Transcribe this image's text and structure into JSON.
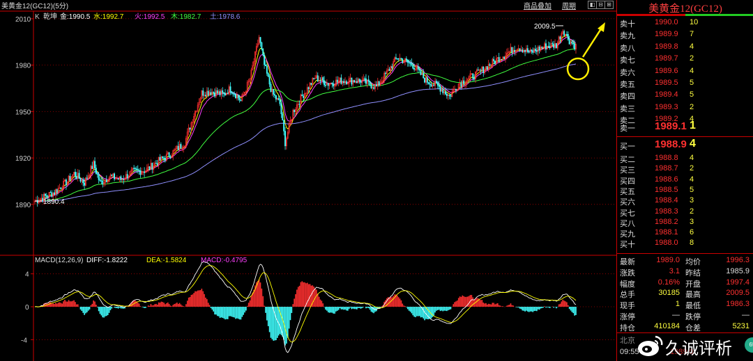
{
  "window": {
    "title": "美黄金12(GC12)(5分)",
    "buttons": [
      "商品叠加",
      "周期"
    ],
    "controls": [
      "◧",
      "⊟",
      "⊞",
      "✕"
    ]
  },
  "legend": {
    "k": "K",
    "indicator": "乾坤",
    "gold": "金:1990.5",
    "water": "水:1992.7",
    "fire": "火:1992.5",
    "wood": "木:1982.7",
    "earth": "土:1978.6",
    "colors": {
      "gold": "#ffffff",
      "water": "#ffff00",
      "fire": "#ff40ff",
      "wood": "#40ff40",
      "earth": "#9090ff"
    }
  },
  "annotations": {
    "high_label": "2009.5",
    "low_label": "1890.4"
  },
  "macd_legend": {
    "name": "MACD(12,26,9)",
    "diff": "DIFF:-1.8222",
    "dea": "DEA:-1.5824",
    "macd": "MACD:-0.4795"
  },
  "chart_data": [
    {
      "type": "candlestick",
      "title": "美黄金12(GC12)(5分)",
      "y_ticks": [
        "2010",
        "1980",
        "1950",
        "1920",
        "1890"
      ],
      "ylim": [
        1858,
        2014
      ],
      "series": [
        {
          "name": "金",
          "value": 1990.5
        },
        {
          "name": "水",
          "value": 1992.7
        },
        {
          "name": "火",
          "value": 1992.5
        },
        {
          "name": "木",
          "value": 1982.7
        },
        {
          "name": "土",
          "value": 1978.6
        }
      ],
      "close_path": [
        [
          0,
          1892
        ],
        [
          15,
          1898
        ],
        [
          25,
          1905
        ],
        [
          30,
          1910
        ],
        [
          38,
          1904
        ],
        [
          45,
          1916
        ],
        [
          50,
          1904
        ],
        [
          58,
          1908
        ],
        [
          66,
          1906
        ],
        [
          75,
          1911
        ],
        [
          85,
          1912
        ],
        [
          95,
          1918
        ],
        [
          105,
          1923
        ],
        [
          115,
          1930
        ],
        [
          122,
          1948
        ],
        [
          128,
          1962
        ],
        [
          135,
          1963
        ],
        [
          145,
          1961
        ],
        [
          150,
          1965
        ],
        [
          158,
          1957
        ],
        [
          165,
          1971
        ],
        [
          172,
          1998
        ],
        [
          176,
          1980
        ],
        [
          182,
          1962
        ],
        [
          188,
          1955
        ],
        [
          192,
          1930
        ],
        [
          198,
          1950
        ],
        [
          205,
          1960
        ],
        [
          215,
          1972
        ],
        [
          225,
          1968
        ],
        [
          235,
          1970
        ],
        [
          250,
          1970
        ],
        [
          262,
          1966
        ],
        [
          270,
          1975
        ],
        [
          278,
          1985
        ],
        [
          290,
          1980
        ],
        [
          300,
          1970
        ],
        [
          310,
          1966
        ],
        [
          318,
          1960
        ],
        [
          325,
          1968
        ],
        [
          340,
          1975
        ],
        [
          355,
          1984
        ],
        [
          370,
          1992
        ],
        [
          380,
          1988
        ],
        [
          390,
          1992
        ],
        [
          400,
          1993
        ],
        [
          405,
          2003
        ],
        [
          410,
          1996
        ],
        [
          415,
          1992
        ]
      ],
      "annotations": [
        {
          "label": "2009.5",
          "x": 405,
          "y": 2009.5
        },
        {
          "label": "1890.4",
          "x": 0,
          "y": 1890.4
        }
      ]
    },
    {
      "type": "bar",
      "title": "MACD(12,26,9)",
      "y_ticks": [
        "4",
        "0",
        "-4"
      ],
      "ylim": [
        -6,
        6
      ],
      "series": [
        {
          "name": "DIFF",
          "value": -1.8222
        },
        {
          "name": "DEA",
          "value": -1.5824
        },
        {
          "name": "MACD",
          "value": -0.4795
        }
      ]
    }
  ],
  "quote_panel": {
    "title": "美黄金12(GC12)",
    "asks": [
      {
        "label": "卖十",
        "price": "1990.0",
        "vol": "10"
      },
      {
        "label": "卖九",
        "price": "1989.9",
        "vol": "7"
      },
      {
        "label": "卖八",
        "price": "1989.8",
        "vol": "4"
      },
      {
        "label": "卖七",
        "price": "1989.7",
        "vol": "2"
      },
      {
        "label": "卖六",
        "price": "1989.6",
        "vol": "4"
      },
      {
        "label": "卖五",
        "price": "1989.5",
        "vol": "5"
      },
      {
        "label": "卖四",
        "price": "1989.4",
        "vol": "5"
      },
      {
        "label": "卖三",
        "price": "1989.3",
        "vol": "2"
      },
      {
        "label": "卖二",
        "price": "1989.2",
        "vol": "4"
      }
    ],
    "ask1": {
      "label": "卖一",
      "price": "1989.1",
      "vol": "1"
    },
    "bid1": {
      "label": "买一",
      "price": "1988.9",
      "vol": "4"
    },
    "bids": [
      {
        "label": "买二",
        "price": "1988.8",
        "vol": "4"
      },
      {
        "label": "买三",
        "price": "1988.7",
        "vol": "2"
      },
      {
        "label": "买四",
        "price": "1988.6",
        "vol": "4"
      },
      {
        "label": "买五",
        "price": "1988.5",
        "vol": "5"
      },
      {
        "label": "买六",
        "price": "1988.4",
        "vol": "3"
      },
      {
        "label": "买七",
        "price": "1988.3",
        "vol": "2"
      },
      {
        "label": "买八",
        "price": "1988.2",
        "vol": "3"
      },
      {
        "label": "买九",
        "price": "1988.1",
        "vol": "6"
      },
      {
        "label": "买十",
        "price": "1988.0",
        "vol": "8"
      }
    ],
    "stats": [
      {
        "l1": "最新",
        "v1": "1989.0",
        "l2": "均价",
        "v2": "1996.3",
        "c1": "#ff3030",
        "c2": "#ff3030"
      },
      {
        "l1": "涨跌",
        "v1": "3.1",
        "l2": "昨结",
        "v2": "1985.9",
        "c1": "#ff3030",
        "c2": "#dddddd"
      },
      {
        "l1": "幅度",
        "v1": "0.16%",
        "l2": "开盘",
        "v2": "1997.4",
        "c1": "#ff3030",
        "c2": "#ff3030"
      },
      {
        "l1": "总手",
        "v1": "30185",
        "l2": "最高",
        "v2": "2009.5",
        "c1": "#ffff40",
        "c2": "#ff3030"
      },
      {
        "l1": "现手",
        "v1": "1",
        "l2": "最低",
        "v2": "1986.3",
        "c1": "#ffff40",
        "c2": "#ff3030"
      },
      {
        "l1": "涨停",
        "v1": "—",
        "l2": "跌停",
        "v2": "—",
        "c1": "#dddddd",
        "c2": "#dddddd"
      },
      {
        "l1": "持仓",
        "v1": "410184",
        "l2": "仓差",
        "v2": "5231",
        "c1": "#ffff40",
        "c2": "#ffff40"
      }
    ],
    "footer": {
      "city": "北京",
      "time": "09:55",
      "price": "1989.0"
    }
  },
  "watermark": {
    "text": "久诚评析"
  }
}
